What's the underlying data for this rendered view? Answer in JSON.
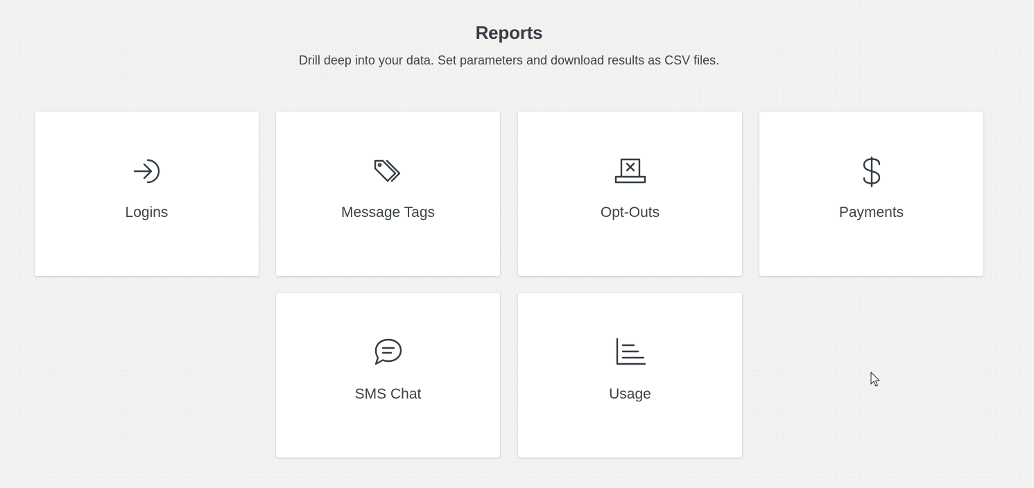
{
  "header": {
    "title": "Reports",
    "subtitle": "Drill deep into your data. Set parameters and download results as CSV files."
  },
  "reports": [
    {
      "label": "Logins",
      "icon": "login-arrow-icon"
    },
    {
      "label": "Message Tags",
      "icon": "tags-icon"
    },
    {
      "label": "Opt-Outs",
      "icon": "opt-out-icon"
    },
    {
      "label": "Payments",
      "icon": "dollar-icon"
    },
    {
      "label": "SMS Chat",
      "icon": "chat-bubble-icon"
    },
    {
      "label": "Usage",
      "icon": "bar-chart-icon"
    }
  ],
  "colors": {
    "background": "#f2f2f1",
    "card": "#ffffff",
    "text": "#343c42"
  }
}
